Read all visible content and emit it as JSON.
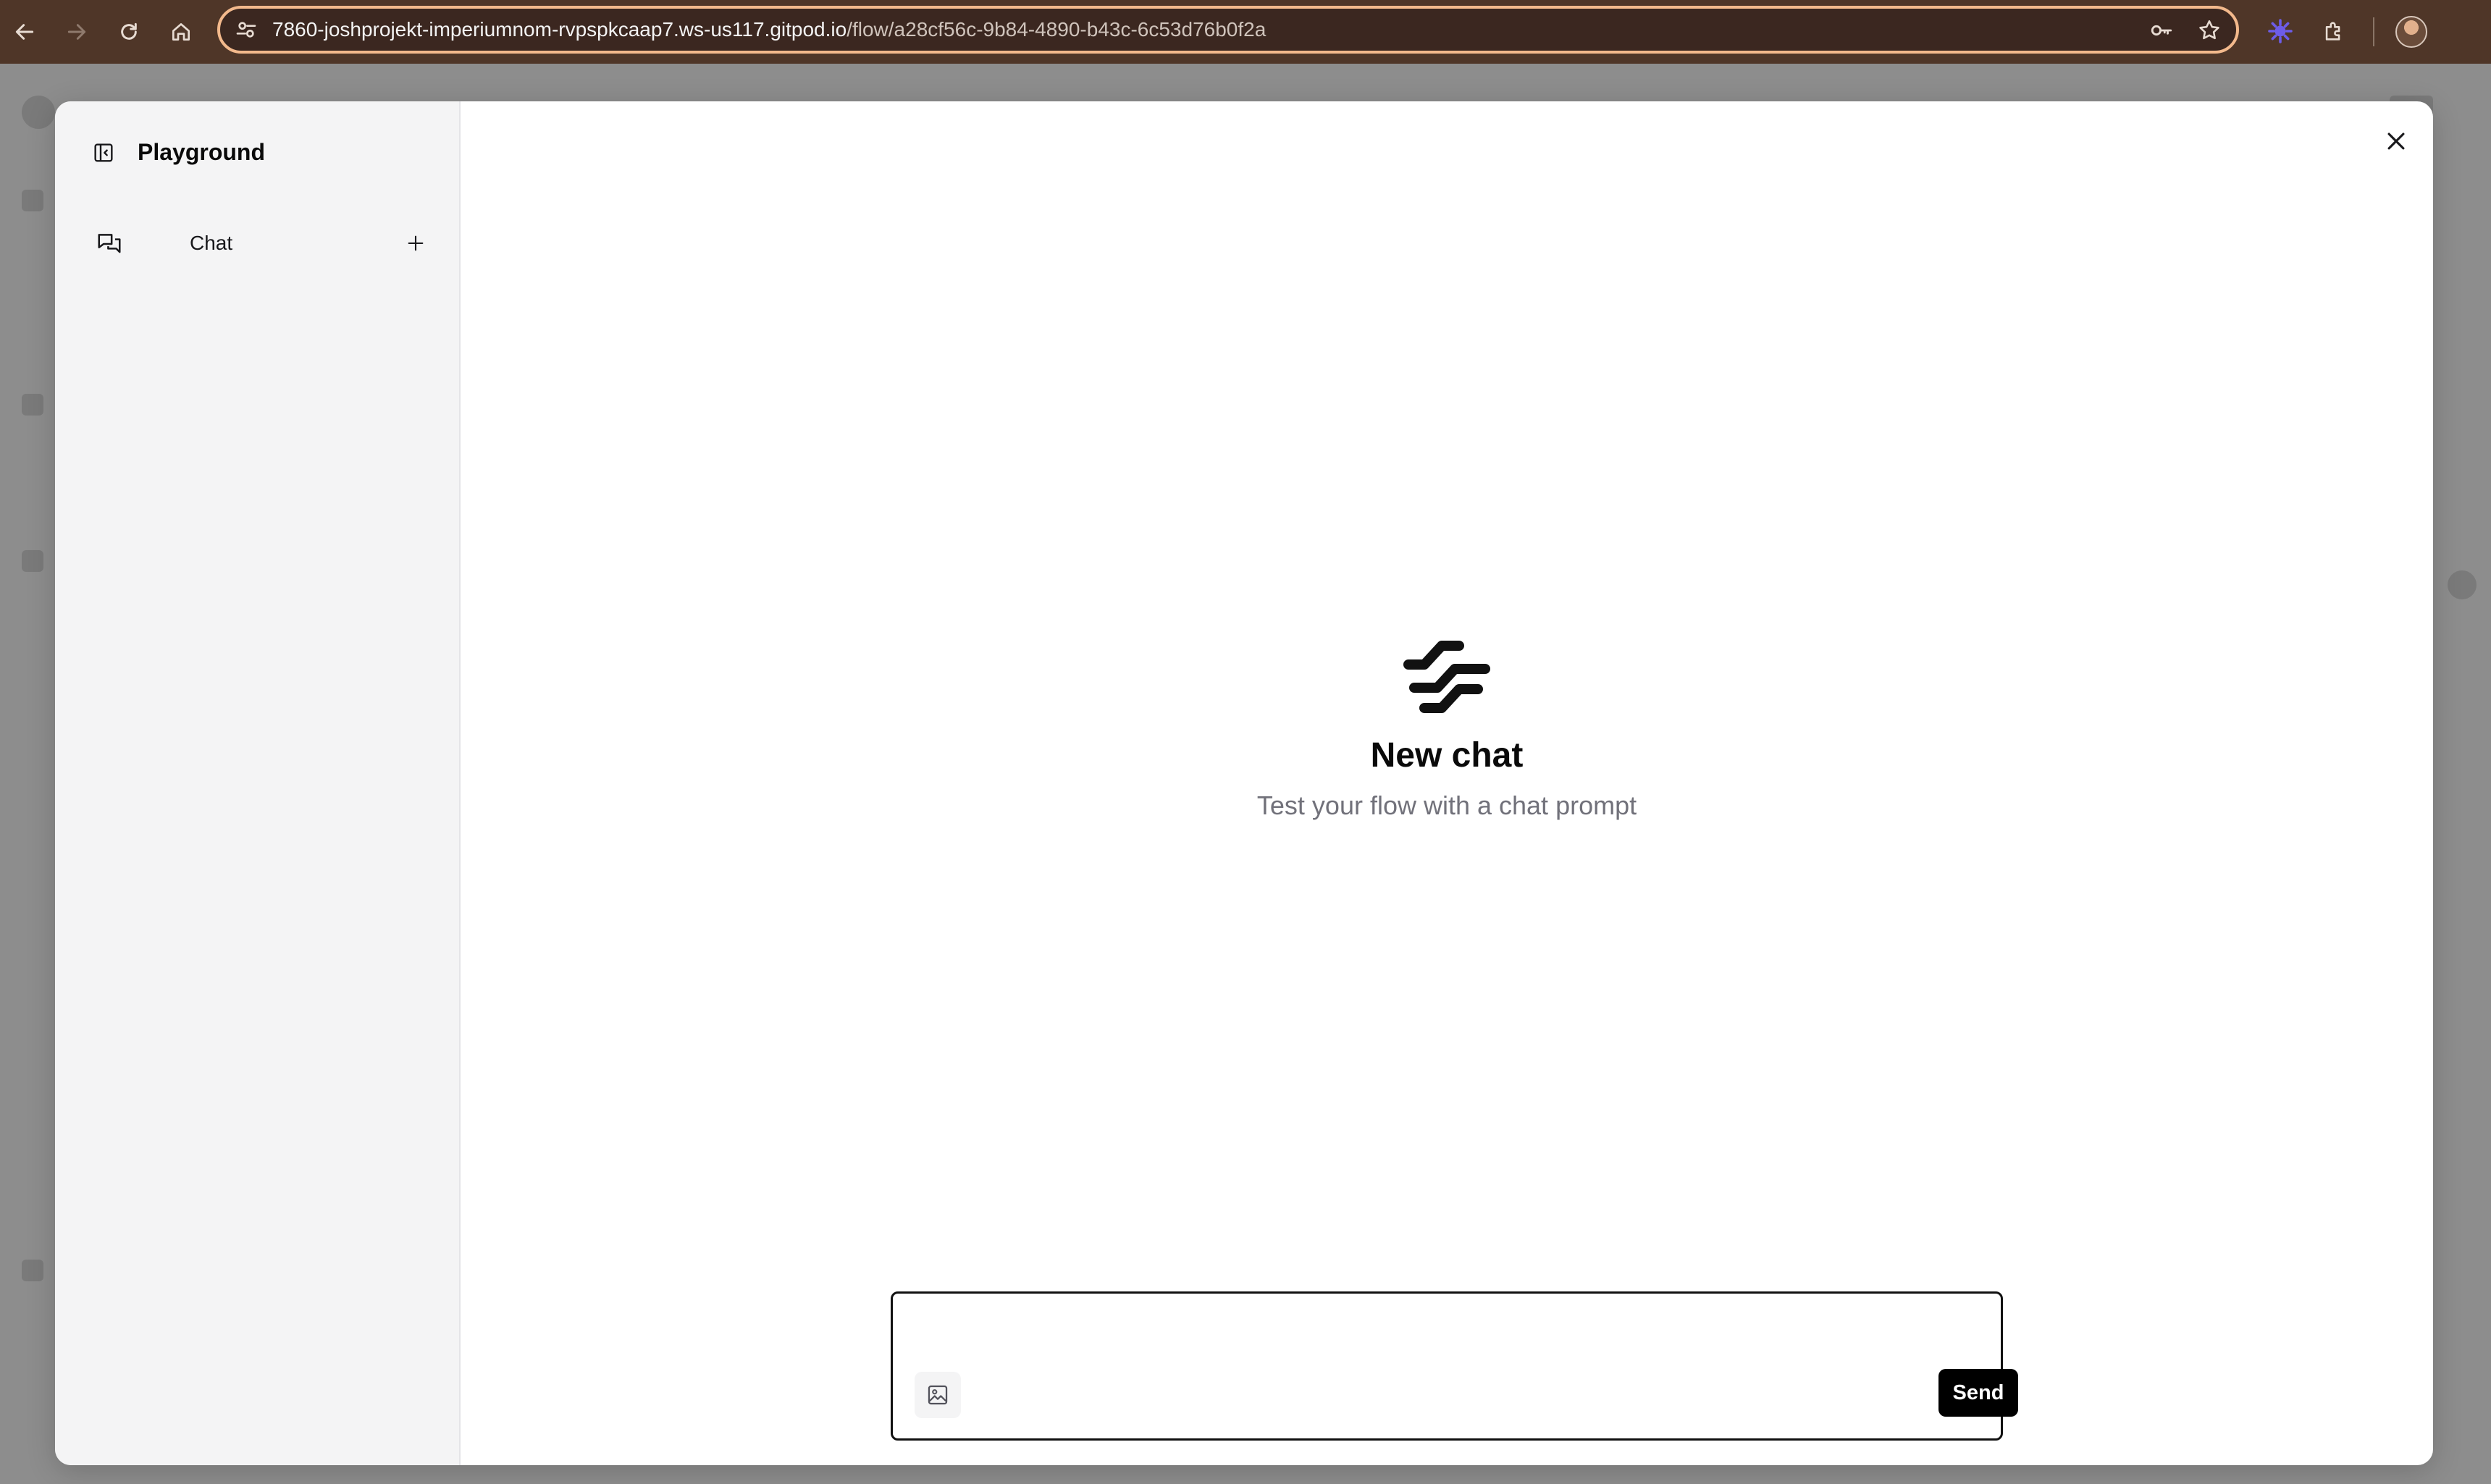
{
  "browser": {
    "url_host": "7860-joshprojekt-imperiumnom-rvpspkcaap7.ws-us117.gitpod.io",
    "url_path": "/flow/a28cf56c-9b84-4890-b43c-6c53d76b0f2a",
    "icons": [
      "back-icon",
      "forward-icon",
      "reload-icon",
      "home-icon",
      "site-settings-icon",
      "password-key-icon",
      "bookmark-star-icon",
      "extension-gear-icon",
      "extensions-puzzle-icon",
      "profile-avatar"
    ],
    "accent_color": "#f3b98c"
  },
  "sidebar": {
    "title": "Playground",
    "sessions": [
      {
        "label": "Chat"
      }
    ]
  },
  "main": {
    "empty_title": "New chat",
    "empty_subtitle": "Test your flow with a chat prompt"
  },
  "input": {
    "placeholder": "",
    "send_label": "Send"
  },
  "colors": {
    "sidebar_bg": "#f4f4f5",
    "send_bg": "#000000",
    "muted_text": "#71717a"
  }
}
